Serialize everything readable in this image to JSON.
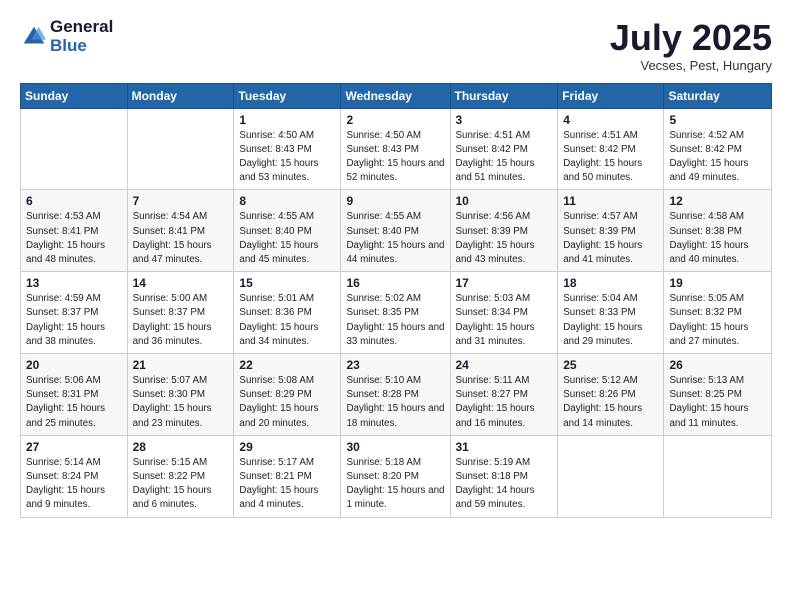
{
  "logo": {
    "general": "General",
    "blue": "Blue"
  },
  "header": {
    "month": "July 2025",
    "location": "Vecses, Pest, Hungary"
  },
  "weekdays": [
    "Sunday",
    "Monday",
    "Tuesday",
    "Wednesday",
    "Thursday",
    "Friday",
    "Saturday"
  ],
  "weeks": [
    [
      {
        "day": "",
        "sunrise": "",
        "sunset": "",
        "daylight": ""
      },
      {
        "day": "",
        "sunrise": "",
        "sunset": "",
        "daylight": ""
      },
      {
        "day": "1",
        "sunrise": "Sunrise: 4:50 AM",
        "sunset": "Sunset: 8:43 PM",
        "daylight": "Daylight: 15 hours and 53 minutes."
      },
      {
        "day": "2",
        "sunrise": "Sunrise: 4:50 AM",
        "sunset": "Sunset: 8:43 PM",
        "daylight": "Daylight: 15 hours and 52 minutes."
      },
      {
        "day": "3",
        "sunrise": "Sunrise: 4:51 AM",
        "sunset": "Sunset: 8:42 PM",
        "daylight": "Daylight: 15 hours and 51 minutes."
      },
      {
        "day": "4",
        "sunrise": "Sunrise: 4:51 AM",
        "sunset": "Sunset: 8:42 PM",
        "daylight": "Daylight: 15 hours and 50 minutes."
      },
      {
        "day": "5",
        "sunrise": "Sunrise: 4:52 AM",
        "sunset": "Sunset: 8:42 PM",
        "daylight": "Daylight: 15 hours and 49 minutes."
      }
    ],
    [
      {
        "day": "6",
        "sunrise": "Sunrise: 4:53 AM",
        "sunset": "Sunset: 8:41 PM",
        "daylight": "Daylight: 15 hours and 48 minutes."
      },
      {
        "day": "7",
        "sunrise": "Sunrise: 4:54 AM",
        "sunset": "Sunset: 8:41 PM",
        "daylight": "Daylight: 15 hours and 47 minutes."
      },
      {
        "day": "8",
        "sunrise": "Sunrise: 4:55 AM",
        "sunset": "Sunset: 8:40 PM",
        "daylight": "Daylight: 15 hours and 45 minutes."
      },
      {
        "day": "9",
        "sunrise": "Sunrise: 4:55 AM",
        "sunset": "Sunset: 8:40 PM",
        "daylight": "Daylight: 15 hours and 44 minutes."
      },
      {
        "day": "10",
        "sunrise": "Sunrise: 4:56 AM",
        "sunset": "Sunset: 8:39 PM",
        "daylight": "Daylight: 15 hours and 43 minutes."
      },
      {
        "day": "11",
        "sunrise": "Sunrise: 4:57 AM",
        "sunset": "Sunset: 8:39 PM",
        "daylight": "Daylight: 15 hours and 41 minutes."
      },
      {
        "day": "12",
        "sunrise": "Sunrise: 4:58 AM",
        "sunset": "Sunset: 8:38 PM",
        "daylight": "Daylight: 15 hours and 40 minutes."
      }
    ],
    [
      {
        "day": "13",
        "sunrise": "Sunrise: 4:59 AM",
        "sunset": "Sunset: 8:37 PM",
        "daylight": "Daylight: 15 hours and 38 minutes."
      },
      {
        "day": "14",
        "sunrise": "Sunrise: 5:00 AM",
        "sunset": "Sunset: 8:37 PM",
        "daylight": "Daylight: 15 hours and 36 minutes."
      },
      {
        "day": "15",
        "sunrise": "Sunrise: 5:01 AM",
        "sunset": "Sunset: 8:36 PM",
        "daylight": "Daylight: 15 hours and 34 minutes."
      },
      {
        "day": "16",
        "sunrise": "Sunrise: 5:02 AM",
        "sunset": "Sunset: 8:35 PM",
        "daylight": "Daylight: 15 hours and 33 minutes."
      },
      {
        "day": "17",
        "sunrise": "Sunrise: 5:03 AM",
        "sunset": "Sunset: 8:34 PM",
        "daylight": "Daylight: 15 hours and 31 minutes."
      },
      {
        "day": "18",
        "sunrise": "Sunrise: 5:04 AM",
        "sunset": "Sunset: 8:33 PM",
        "daylight": "Daylight: 15 hours and 29 minutes."
      },
      {
        "day": "19",
        "sunrise": "Sunrise: 5:05 AM",
        "sunset": "Sunset: 8:32 PM",
        "daylight": "Daylight: 15 hours and 27 minutes."
      }
    ],
    [
      {
        "day": "20",
        "sunrise": "Sunrise: 5:06 AM",
        "sunset": "Sunset: 8:31 PM",
        "daylight": "Daylight: 15 hours and 25 minutes."
      },
      {
        "day": "21",
        "sunrise": "Sunrise: 5:07 AM",
        "sunset": "Sunset: 8:30 PM",
        "daylight": "Daylight: 15 hours and 23 minutes."
      },
      {
        "day": "22",
        "sunrise": "Sunrise: 5:08 AM",
        "sunset": "Sunset: 8:29 PM",
        "daylight": "Daylight: 15 hours and 20 minutes."
      },
      {
        "day": "23",
        "sunrise": "Sunrise: 5:10 AM",
        "sunset": "Sunset: 8:28 PM",
        "daylight": "Daylight: 15 hours and 18 minutes."
      },
      {
        "day": "24",
        "sunrise": "Sunrise: 5:11 AM",
        "sunset": "Sunset: 8:27 PM",
        "daylight": "Daylight: 15 hours and 16 minutes."
      },
      {
        "day": "25",
        "sunrise": "Sunrise: 5:12 AM",
        "sunset": "Sunset: 8:26 PM",
        "daylight": "Daylight: 15 hours and 14 minutes."
      },
      {
        "day": "26",
        "sunrise": "Sunrise: 5:13 AM",
        "sunset": "Sunset: 8:25 PM",
        "daylight": "Daylight: 15 hours and 11 minutes."
      }
    ],
    [
      {
        "day": "27",
        "sunrise": "Sunrise: 5:14 AM",
        "sunset": "Sunset: 8:24 PM",
        "daylight": "Daylight: 15 hours and 9 minutes."
      },
      {
        "day": "28",
        "sunrise": "Sunrise: 5:15 AM",
        "sunset": "Sunset: 8:22 PM",
        "daylight": "Daylight: 15 hours and 6 minutes."
      },
      {
        "day": "29",
        "sunrise": "Sunrise: 5:17 AM",
        "sunset": "Sunset: 8:21 PM",
        "daylight": "Daylight: 15 hours and 4 minutes."
      },
      {
        "day": "30",
        "sunrise": "Sunrise: 5:18 AM",
        "sunset": "Sunset: 8:20 PM",
        "daylight": "Daylight: 15 hours and 1 minute."
      },
      {
        "day": "31",
        "sunrise": "Sunrise: 5:19 AM",
        "sunset": "Sunset: 8:18 PM",
        "daylight": "Daylight: 14 hours and 59 minutes."
      },
      {
        "day": "",
        "sunrise": "",
        "sunset": "",
        "daylight": ""
      },
      {
        "day": "",
        "sunrise": "",
        "sunset": "",
        "daylight": ""
      }
    ]
  ]
}
